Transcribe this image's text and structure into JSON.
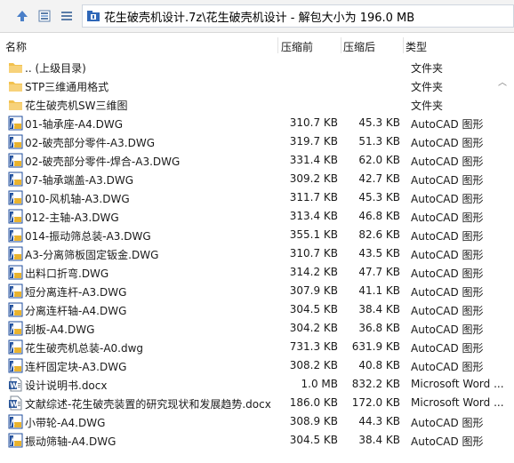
{
  "address": {
    "path": "花生破壳机设计.7z\\花生破壳机设计 - 解包大小为 196.0 MB"
  },
  "columns": {
    "name": "名称",
    "compressed": "压缩前",
    "size": "压缩后",
    "type": "类型"
  },
  "files": [
    {
      "icon": "folder",
      "name": ".. (上级目录)",
      "compressed": "",
      "size": "",
      "type": "文件夹"
    },
    {
      "icon": "folder",
      "name": "STP三维通用格式",
      "compressed": "",
      "size": "",
      "type": "文件夹"
    },
    {
      "icon": "folder",
      "name": "花生破壳机SW三维图",
      "compressed": "",
      "size": "",
      "type": "文件夹"
    },
    {
      "icon": "dwg",
      "name": "01-轴承座-A4.DWG",
      "compressed": "310.7 KB",
      "size": "45.3 KB",
      "type": "AutoCAD 图形"
    },
    {
      "icon": "dwg",
      "name": "02-破壳部分零件-A3.DWG",
      "compressed": "319.7 KB",
      "size": "51.3 KB",
      "type": "AutoCAD 图形"
    },
    {
      "icon": "dwg",
      "name": "02-破壳部分零件-焊合-A3.DWG",
      "compressed": "331.4 KB",
      "size": "62.0 KB",
      "type": "AutoCAD 图形"
    },
    {
      "icon": "dwg",
      "name": "07-轴承端盖-A3.DWG",
      "compressed": "309.2 KB",
      "size": "42.7 KB",
      "type": "AutoCAD 图形"
    },
    {
      "icon": "dwg",
      "name": "010-风机轴-A3.DWG",
      "compressed": "311.7 KB",
      "size": "45.3 KB",
      "type": "AutoCAD 图形"
    },
    {
      "icon": "dwg",
      "name": "012-主轴-A3.DWG",
      "compressed": "313.4 KB",
      "size": "46.8 KB",
      "type": "AutoCAD 图形"
    },
    {
      "icon": "dwg",
      "name": "014-振动筛总装-A3.DWG",
      "compressed": "355.1 KB",
      "size": "82.6 KB",
      "type": "AutoCAD 图形"
    },
    {
      "icon": "dwg",
      "name": "A3-分离筛板固定钣金.DWG",
      "compressed": "310.7 KB",
      "size": "43.5 KB",
      "type": "AutoCAD 图形"
    },
    {
      "icon": "dwg",
      "name": "出料口折弯.DWG",
      "compressed": "314.2 KB",
      "size": "47.7 KB",
      "type": "AutoCAD 图形"
    },
    {
      "icon": "dwg",
      "name": "短分离连杆-A3.DWG",
      "compressed": "307.9 KB",
      "size": "41.1 KB",
      "type": "AutoCAD 图形"
    },
    {
      "icon": "dwg",
      "name": "分离连杆轴-A4.DWG",
      "compressed": "304.5 KB",
      "size": "38.4 KB",
      "type": "AutoCAD 图形"
    },
    {
      "icon": "dwg",
      "name": "刮板-A4.DWG",
      "compressed": "304.2 KB",
      "size": "36.8 KB",
      "type": "AutoCAD 图形"
    },
    {
      "icon": "dwg",
      "name": "花生破壳机总装-A0.dwg",
      "compressed": "731.3 KB",
      "size": "631.9 KB",
      "type": "AutoCAD 图形"
    },
    {
      "icon": "dwg",
      "name": "连杆固定块-A3.DWG",
      "compressed": "308.2 KB",
      "size": "40.8 KB",
      "type": "AutoCAD 图形"
    },
    {
      "icon": "doc",
      "name": "设计说明书.docx",
      "compressed": "1.0 MB",
      "size": "832.2 KB",
      "type": "Microsoft Word ..."
    },
    {
      "icon": "doc",
      "name": "文献综述-花生破壳装置的研究现状和发展趋势.docx",
      "compressed": "186.0 KB",
      "size": "172.0 KB",
      "type": "Microsoft Word ..."
    },
    {
      "icon": "dwg",
      "name": "小带轮-A4.DWG",
      "compressed": "308.9 KB",
      "size": "44.3 KB",
      "type": "AutoCAD 图形"
    },
    {
      "icon": "dwg",
      "name": "振动筛轴-A4.DWG",
      "compressed": "304.5 KB",
      "size": "38.4 KB",
      "type": "AutoCAD 图形"
    }
  ],
  "colors": {
    "folder": "#f2c14e",
    "dwg_frame": "#1f4e9c",
    "dwg_accent": "#e8b22e",
    "doc": "#2b579a"
  }
}
